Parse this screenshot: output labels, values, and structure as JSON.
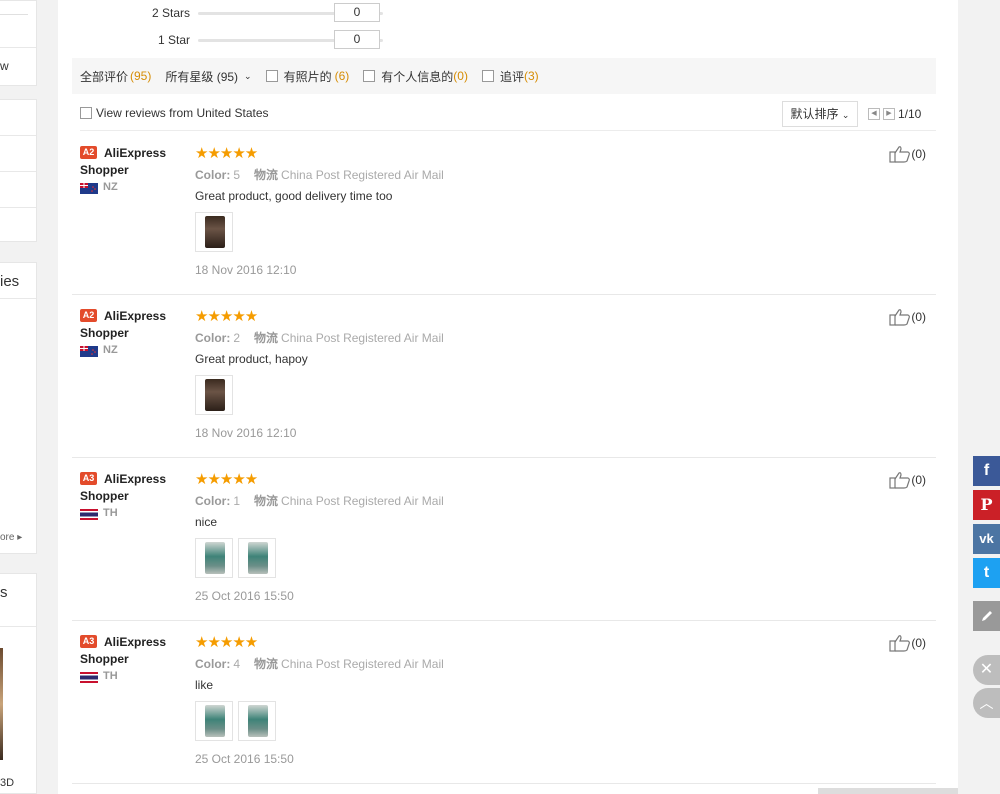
{
  "sidebar": {
    "fragment_a": "w",
    "fragment_b": "ies",
    "more": "ore",
    "fragment_c": "s",
    "fragment_d": "3D"
  },
  "rating_breakdown": [
    {
      "label": "2 Stars",
      "count": "0"
    },
    {
      "label": "1 Star",
      "count": "0"
    }
  ],
  "filters": {
    "all_label": "全部评价",
    "all_count": "(95)",
    "star_select": "所有星级 (95)",
    "photos_label": "有照片的",
    "photos_count": "(6)",
    "personal_label": "有个人信息的",
    "personal_count": "(0)",
    "followup_label": "追评",
    "followup_count": "(3)"
  },
  "view": {
    "from_us_label": "View reviews from United States",
    "sort_label": "默认排序",
    "page_info": "1/10"
  },
  "reviews": [
    {
      "level": "A2",
      "name": "AliExpress Shopper",
      "country": "NZ",
      "stars": "★★★★★",
      "color_label": "Color:",
      "color": "5",
      "logistics_label": "物流",
      "logistics": "China Post Registered Air Mail",
      "text": "Great product, good delivery time too",
      "date": "18 Nov 2016 12:10",
      "likes": "(0)"
    },
    {
      "level": "A2",
      "name": "AliExpress Shopper",
      "country": "NZ",
      "stars": "★★★★★",
      "color_label": "Color:",
      "color": "2",
      "logistics_label": "物流",
      "logistics": "China Post Registered Air Mail",
      "text": "Great product, hapoy",
      "date": "18 Nov 2016 12:10",
      "likes": "(0)"
    },
    {
      "level": "A3",
      "name": "AliExpress Shopper",
      "country": "TH",
      "stars": "★★★★★",
      "color_label": "Color:",
      "color": "1",
      "logistics_label": "物流",
      "logistics": "China Post Registered Air Mail",
      "text": "nice",
      "date": "25 Oct 2016 15:50",
      "likes": "(0)"
    },
    {
      "level": "A3",
      "name": "AliExpress Shopper",
      "country": "TH",
      "stars": "★★★★★",
      "color_label": "Color:",
      "color": "4",
      "logistics_label": "物流",
      "logistics": "China Post Registered Air Mail",
      "text": "like",
      "date": "25 Oct 2016 15:50",
      "likes": "(0)"
    }
  ],
  "share": {
    "facebook": "f",
    "pinterest": "P",
    "vk": "vk",
    "twitter": "t"
  },
  "colors": {
    "star": "#f59c00",
    "badge": "#e34b2b",
    "count_orange": "#d68d05",
    "facebook": "#3b5998",
    "pinterest": "#cb2027",
    "vk": "#4c75a3",
    "twitter": "#1da1f2"
  }
}
